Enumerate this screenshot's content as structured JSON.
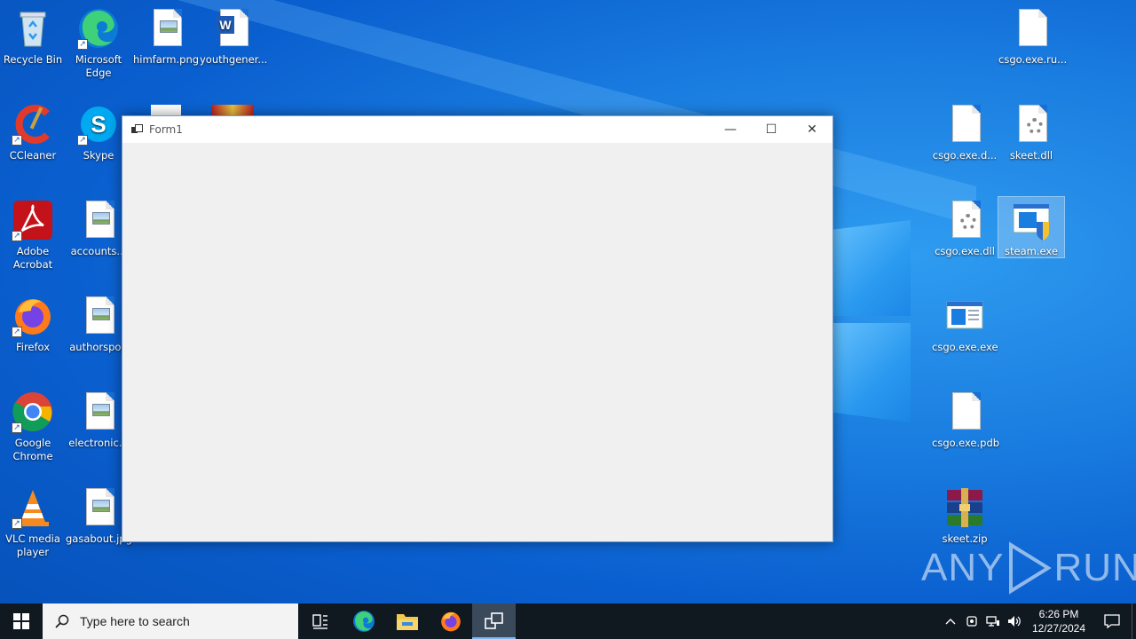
{
  "desktop": {
    "icons_left": [
      {
        "label": "Recycle Bin"
      },
      {
        "label": "Microsoft Edge"
      },
      {
        "label": "himfarm.png"
      },
      {
        "label": "youthgener..."
      },
      {
        "label": "CCleaner"
      },
      {
        "label": "Skype"
      },
      {
        "label": "Adobe Acrobat"
      },
      {
        "label": "accounts..."
      },
      {
        "label": "Firefox"
      },
      {
        "label": "authorspop"
      },
      {
        "label": "Google Chrome"
      },
      {
        "label": "electronic..."
      },
      {
        "label": "VLC media player"
      },
      {
        "label": "gasabout.jpg"
      }
    ],
    "icons_right": [
      {
        "label": "csgo.exe.ru..."
      },
      {
        "label": "csgo.exe.d..."
      },
      {
        "label": "skeet.dll"
      },
      {
        "label": "csgo.exe.dll"
      },
      {
        "label": "steam.exe",
        "selected": true
      },
      {
        "label": "csgo.exe.exe"
      },
      {
        "label": "csgo.exe.pdb"
      },
      {
        "label": "skeet.zip"
      }
    ]
  },
  "window": {
    "title": "Form1",
    "minimize_glyph": "—",
    "maximize_glyph": "☐",
    "close_glyph": "✕"
  },
  "taskbar": {
    "search_placeholder": "Type here to search",
    "clock_time": "6:26 PM",
    "clock_date": "12/27/2024"
  },
  "watermark": {
    "text_left": "ANY",
    "text_right": "RUN"
  },
  "colors": {
    "desktop_blue": "#0a5fcf",
    "taskbar": "#101820",
    "window_bg": "#f0f0f0",
    "accent": "#7ab8f5"
  }
}
